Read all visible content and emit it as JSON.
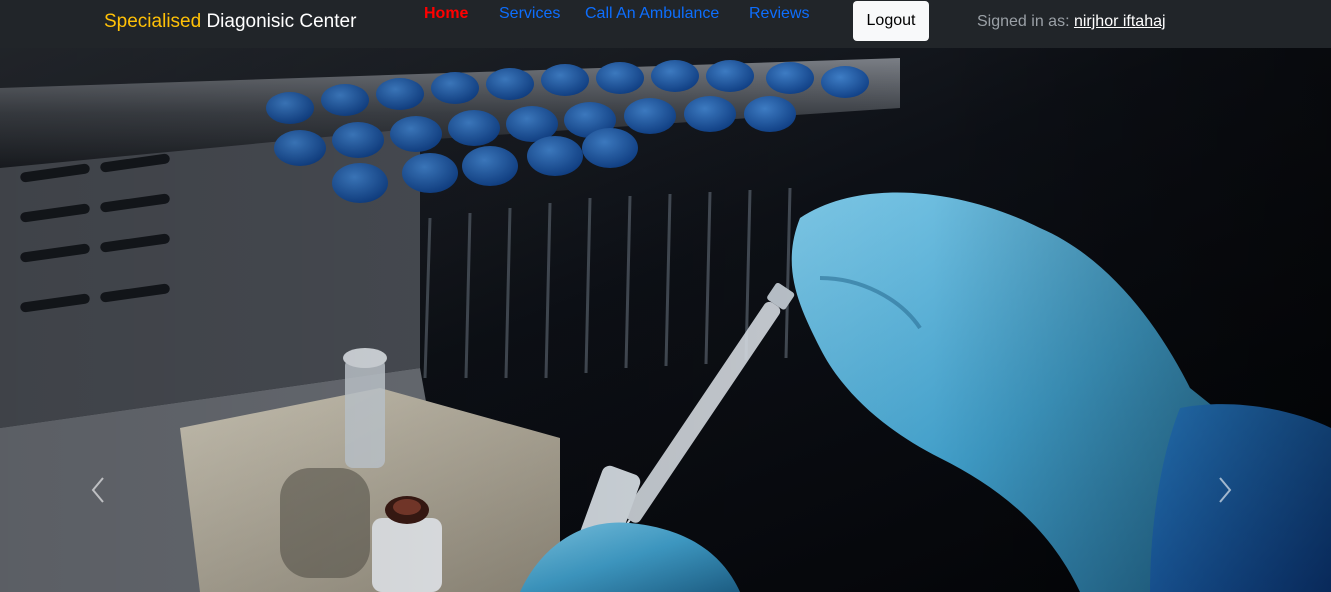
{
  "navbar": {
    "brand": {
      "accent": "Specialised",
      "main": " Diagonisic Center"
    },
    "links": [
      {
        "label": "Home",
        "active": true
      },
      {
        "label": "Services",
        "active": false
      },
      {
        "label": "Call An Ambulance",
        "active": false
      },
      {
        "label": "Reviews",
        "active": false
      }
    ],
    "logout_label": "Logout",
    "signed_in_label": "Signed in as: ",
    "user_name": "nirjhor iftahaj"
  },
  "carousel": {
    "image": "lab-technician-syringe-photo",
    "prev_icon": "chevron-left-icon",
    "next_icon": "chevron-right-icon"
  },
  "colors": {
    "navbar_bg": "#212529",
    "brand_accent": "#ffc107",
    "active_link": "#ff0000",
    "link": "#0d6efd",
    "logout_bg": "#f8f9fa"
  }
}
